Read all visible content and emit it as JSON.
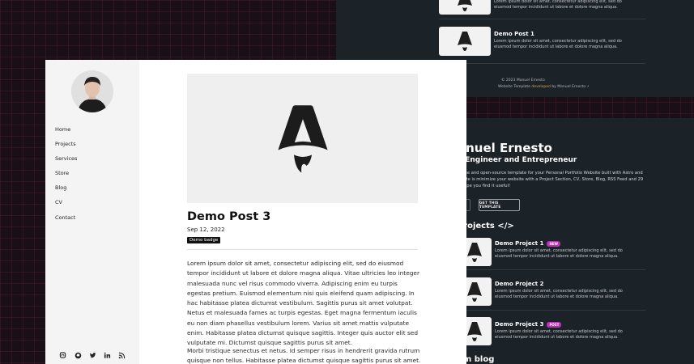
{
  "top_panel": {
    "post_excerpt_top": "Lorem ipsum dolor sit amet, consectetur adipiscing elit, sed do eiusmod tempor incididunt ut labore et dolore magna aliqua.",
    "post": {
      "title": "Demo Post 1",
      "excerpt": "Lorem ipsum dolor sit amet, consectetur adipiscing elit, sed do eiusmod tempor incididunt ut labore et dolore magna aliqua."
    },
    "copyright": "© 2023 Manuel Ernesto",
    "footer_prefix": "Website Template ",
    "footer_link": "developed",
    "footer_suffix": " by Manuel Ernesto ⚡"
  },
  "hero": {
    "name": "anuel Ernesto",
    "role": "e Engineer and Entrepreneur",
    "description": "a free and open-source template for your Personal Portfolio Website built with Astro and ebsite is minimize your website with a Project Section, CV, Store, Blog, RSS Feed and 29 e hope you find it useful!",
    "cta_label": "GET THIS TEMPLATE",
    "projects_heading": "projects </>",
    "blog_heading": "om blog"
  },
  "projects": [
    {
      "title": "Demo Project 1",
      "badge": "NEW",
      "excerpt": "Lorem ipsum dolor sit amet, consectetur adipiscing elit, sed do eiusmod tempor incididunt ut labore et dolore magna aliqua."
    },
    {
      "title": "Demo Project 2",
      "badge": "",
      "excerpt": "Lorem ipsum dolor sit amet, consectetur adipiscing elit, sed do eiusmod tempor incididunt ut labore et dolore magna aliqua."
    },
    {
      "title": "Demo Project 3",
      "badge": "POST",
      "excerpt": "Lorem ipsum dolor sit amet, consectetur adipiscing elit, sed do eiusmod tempor incididunt ut labore et dolore magna aliqua."
    }
  ],
  "sidebar": {
    "nav": [
      "Home",
      "Projects",
      "Services",
      "Store",
      "Blog",
      "CV",
      "Contact"
    ],
    "social_icons": [
      "mastodon-icon",
      "github-icon",
      "twitter-icon",
      "linkedin-icon",
      "rss-icon"
    ]
  },
  "post": {
    "title": "Demo Post 3",
    "date": "Sep 12, 2022",
    "badge": "Demo badge",
    "paragraph_1": "Lorem ipsum dolor sit amet, consectetur adipiscing elit, sed do eiusmod tempor incididunt ut labore et dolore magna aliqua. Vitae ultricies leo integer malesuada nunc vel risus commodo viverra. Adipiscing enim eu turpis egestas pretium. Euismod elementum nisi quis eleifend quam adipiscing. In hac habitasse platea dictumst vestibulum. Sagittis purus sit amet volutpat. Netus et malesuada fames ac turpis egestas. Eget magna fermentum iaculis eu non diam phasellus vestibulum lorem. Varius sit amet mattis vulputate enim. Habitasse platea dictumst quisque sagittis. Integer quis auctor elit sed vulputate mi. Dictumst quisque sagittis purus sit amet.",
    "paragraph_2": "Morbi tristique senectus et netus. Id semper risus in hendrerit gravida rutrum quisque non tellus. Habitasse platea dictumst quisque sagittis purus sit amet. Tellus molestie nunc non"
  },
  "colors": {
    "background": "#1a0f16",
    "dark_panel": "#1b2228",
    "badge_pink": "#c02fb5",
    "accent_gold": "#d2a44b"
  }
}
